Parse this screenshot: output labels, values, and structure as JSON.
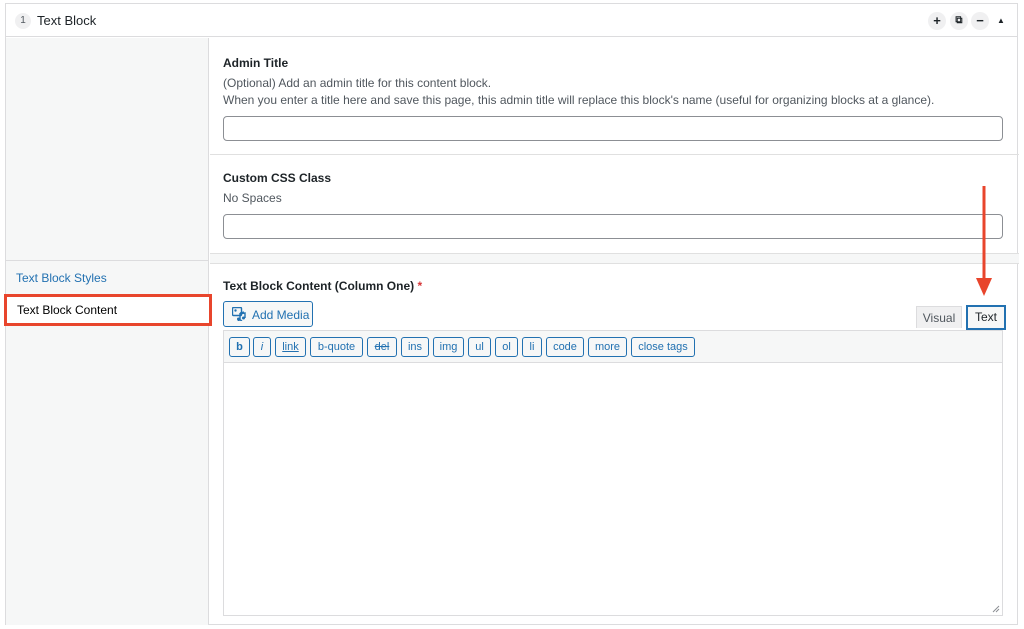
{
  "header": {
    "order": "1",
    "title": "Text Block",
    "buttons": {
      "add": "+",
      "duplicate": "⧉",
      "collapse": "−",
      "toggle": "▲"
    }
  },
  "sidebar": {
    "items": [
      {
        "label": "Text Block Styles",
        "active": false
      },
      {
        "label": "Text Block Content",
        "active": true
      }
    ]
  },
  "fields": {
    "admin_title": {
      "label": "Admin Title",
      "description_1": "(Optional) Add an admin title for this content block.",
      "description_2": "When you enter a title here and save this page, this admin title will replace this block's name (useful for organizing blocks at a glance).",
      "value": ""
    },
    "css_class": {
      "label": "Custom CSS Class",
      "description": "No Spaces",
      "value": ""
    },
    "content": {
      "label": "Text Block Content (Column One)",
      "required_mark": "*",
      "add_media": "Add Media",
      "tabs": {
        "visual": "Visual",
        "text": "Text"
      },
      "active_tab": "Text",
      "quicktags": [
        "b",
        "i",
        "link",
        "b-quote",
        "del",
        "ins",
        "img",
        "ul",
        "ol",
        "li",
        "code",
        "more",
        "close tags"
      ],
      "value": ""
    }
  },
  "colors": {
    "accent": "#2271b1",
    "highlight": "#e8452c",
    "required": "#d63638"
  }
}
